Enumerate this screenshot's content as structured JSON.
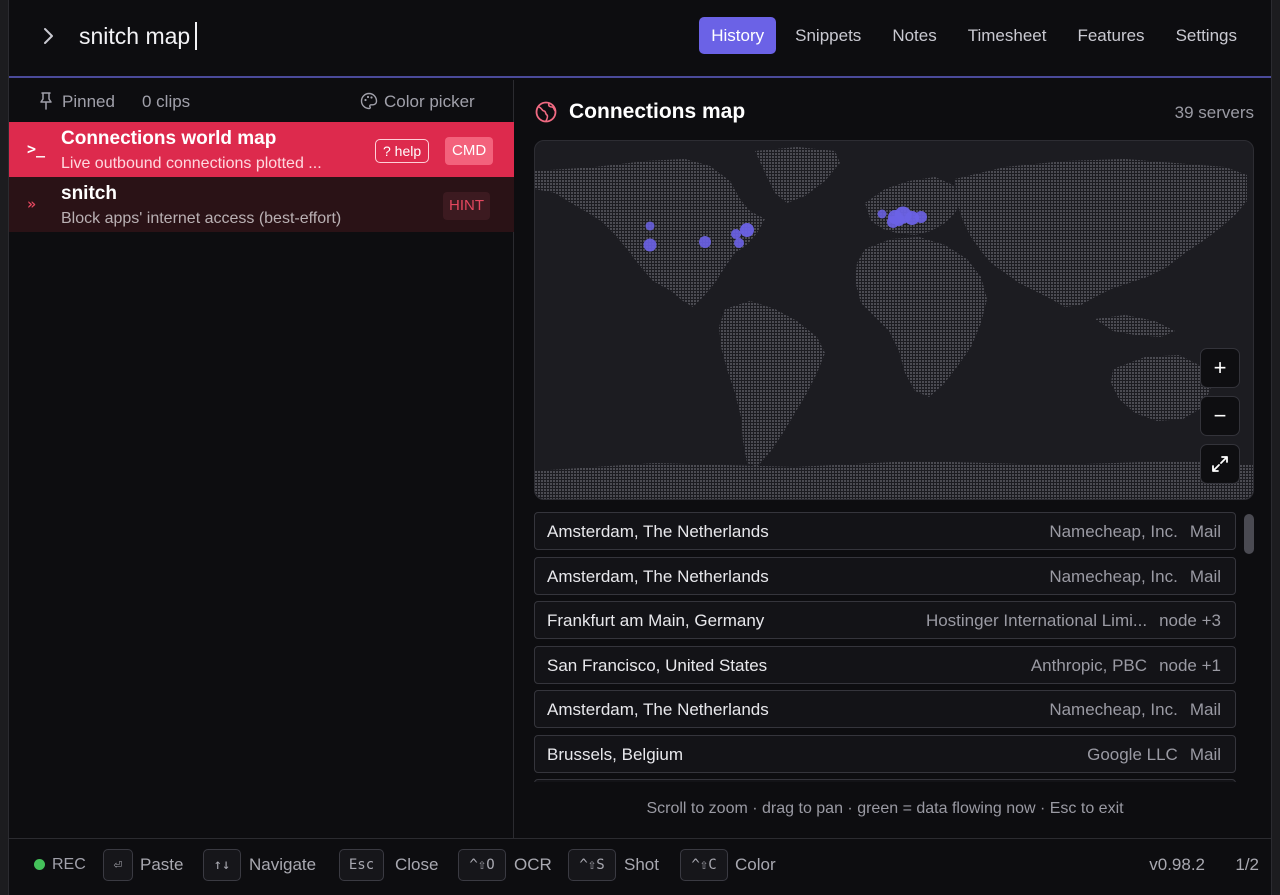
{
  "search": {
    "value": "snitch map"
  },
  "tabs": [
    {
      "label": "History",
      "active": true
    },
    {
      "label": "Snippets",
      "active": false
    },
    {
      "label": "Notes",
      "active": false
    },
    {
      "label": "Timesheet",
      "active": false
    },
    {
      "label": "Features",
      "active": false
    },
    {
      "label": "Settings",
      "active": false
    }
  ],
  "left": {
    "pinned_label": "Pinned",
    "clips_label": "0 clips",
    "color_picker_label": "Color picker",
    "results": [
      {
        "icon": "terminal-icon",
        "title": "Connections world map",
        "subtitle": "Live outbound connections plotted ...",
        "help": "? help",
        "badge": "CMD"
      },
      {
        "icon": "double-chevron-icon",
        "title": "snitch",
        "subtitle": "Block apps' internet access (best-effort)",
        "badge": "HINT"
      }
    ]
  },
  "map_panel": {
    "title": "Connections map",
    "server_count": "39 servers",
    "zoom_in": "+",
    "zoom_out": "−",
    "connections": [
      {
        "location": "Amsterdam, The Netherlands",
        "org": "Namecheap, Inc.",
        "app": "Mail"
      },
      {
        "location": "Amsterdam, The Netherlands",
        "org": "Namecheap, Inc.",
        "app": "Mail"
      },
      {
        "location": "Frankfurt am Main, Germany",
        "org": "Hostinger International Limi...",
        "app": "node +3"
      },
      {
        "location": "San Francisco, United States",
        "org": "Anthropic, PBC",
        "app": "node +1"
      },
      {
        "location": "Amsterdam, The Netherlands",
        "org": "Namecheap, Inc.",
        "app": "Mail"
      },
      {
        "location": "Brussels, Belgium",
        "org": "Google LLC",
        "app": "Mail"
      }
    ],
    "hint": "Scroll to zoom · drag to pan · green = data flowing now · Esc to exit",
    "accent_color": "#6b62e6"
  },
  "bottom": {
    "rec_label": "REC",
    "shortcuts": [
      {
        "key": "⏎",
        "label": "Paste"
      },
      {
        "key": "↑↓",
        "label": "Navigate"
      },
      {
        "key": "Esc",
        "label": "Close"
      },
      {
        "key": "^⇧O",
        "label": "OCR"
      },
      {
        "key": "^⇧S",
        "label": "Shot"
      },
      {
        "key": "^⇧C",
        "label": "Color"
      }
    ],
    "version": "v0.98.2",
    "page": "1/2"
  }
}
